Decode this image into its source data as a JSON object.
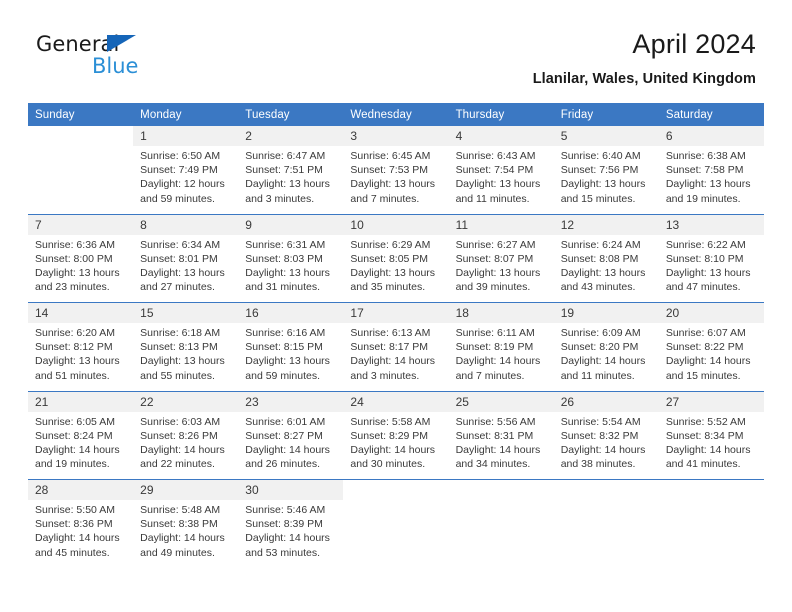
{
  "brand": {
    "line1": "General",
    "line2": "Blue",
    "triangle_color": "#1565b8",
    "line2_color": "#2b8fd6"
  },
  "header": {
    "title": "April 2024",
    "subtitle": "Llanilar, Wales, United Kingdom"
  },
  "theme": {
    "header_bg": "#3b78c3",
    "header_text": "#ffffff",
    "daynum_bg": "#f1f1f1",
    "rule_color": "#3b78c3",
    "body_text": "#3a3a3a"
  },
  "weekday_headers": [
    "Sunday",
    "Monday",
    "Tuesday",
    "Wednesday",
    "Thursday",
    "Friday",
    "Saturday"
  ],
  "weeks": [
    [
      {
        "day": "",
        "lines": []
      },
      {
        "day": "1",
        "lines": [
          "Sunrise: 6:50 AM",
          "Sunset: 7:49 PM",
          "Daylight: 12 hours",
          "and 59 minutes."
        ]
      },
      {
        "day": "2",
        "lines": [
          "Sunrise: 6:47 AM",
          "Sunset: 7:51 PM",
          "Daylight: 13 hours",
          "and 3 minutes."
        ]
      },
      {
        "day": "3",
        "lines": [
          "Sunrise: 6:45 AM",
          "Sunset: 7:53 PM",
          "Daylight: 13 hours",
          "and 7 minutes."
        ]
      },
      {
        "day": "4",
        "lines": [
          "Sunrise: 6:43 AM",
          "Sunset: 7:54 PM",
          "Daylight: 13 hours",
          "and 11 minutes."
        ]
      },
      {
        "day": "5",
        "lines": [
          "Sunrise: 6:40 AM",
          "Sunset: 7:56 PM",
          "Daylight: 13 hours",
          "and 15 minutes."
        ]
      },
      {
        "day": "6",
        "lines": [
          "Sunrise: 6:38 AM",
          "Sunset: 7:58 PM",
          "Daylight: 13 hours",
          "and 19 minutes."
        ]
      }
    ],
    [
      {
        "day": "7",
        "lines": [
          "Sunrise: 6:36 AM",
          "Sunset: 8:00 PM",
          "Daylight: 13 hours",
          "and 23 minutes."
        ]
      },
      {
        "day": "8",
        "lines": [
          "Sunrise: 6:34 AM",
          "Sunset: 8:01 PM",
          "Daylight: 13 hours",
          "and 27 minutes."
        ]
      },
      {
        "day": "9",
        "lines": [
          "Sunrise: 6:31 AM",
          "Sunset: 8:03 PM",
          "Daylight: 13 hours",
          "and 31 minutes."
        ]
      },
      {
        "day": "10",
        "lines": [
          "Sunrise: 6:29 AM",
          "Sunset: 8:05 PM",
          "Daylight: 13 hours",
          "and 35 minutes."
        ]
      },
      {
        "day": "11",
        "lines": [
          "Sunrise: 6:27 AM",
          "Sunset: 8:07 PM",
          "Daylight: 13 hours",
          "and 39 minutes."
        ]
      },
      {
        "day": "12",
        "lines": [
          "Sunrise: 6:24 AM",
          "Sunset: 8:08 PM",
          "Daylight: 13 hours",
          "and 43 minutes."
        ]
      },
      {
        "day": "13",
        "lines": [
          "Sunrise: 6:22 AM",
          "Sunset: 8:10 PM",
          "Daylight: 13 hours",
          "and 47 minutes."
        ]
      }
    ],
    [
      {
        "day": "14",
        "lines": [
          "Sunrise: 6:20 AM",
          "Sunset: 8:12 PM",
          "Daylight: 13 hours",
          "and 51 minutes."
        ]
      },
      {
        "day": "15",
        "lines": [
          "Sunrise: 6:18 AM",
          "Sunset: 8:13 PM",
          "Daylight: 13 hours",
          "and 55 minutes."
        ]
      },
      {
        "day": "16",
        "lines": [
          "Sunrise: 6:16 AM",
          "Sunset: 8:15 PM",
          "Daylight: 13 hours",
          "and 59 minutes."
        ]
      },
      {
        "day": "17",
        "lines": [
          "Sunrise: 6:13 AM",
          "Sunset: 8:17 PM",
          "Daylight: 14 hours",
          "and 3 minutes."
        ]
      },
      {
        "day": "18",
        "lines": [
          "Sunrise: 6:11 AM",
          "Sunset: 8:19 PM",
          "Daylight: 14 hours",
          "and 7 minutes."
        ]
      },
      {
        "day": "19",
        "lines": [
          "Sunrise: 6:09 AM",
          "Sunset: 8:20 PM",
          "Daylight: 14 hours",
          "and 11 minutes."
        ]
      },
      {
        "day": "20",
        "lines": [
          "Sunrise: 6:07 AM",
          "Sunset: 8:22 PM",
          "Daylight: 14 hours",
          "and 15 minutes."
        ]
      }
    ],
    [
      {
        "day": "21",
        "lines": [
          "Sunrise: 6:05 AM",
          "Sunset: 8:24 PM",
          "Daylight: 14 hours",
          "and 19 minutes."
        ]
      },
      {
        "day": "22",
        "lines": [
          "Sunrise: 6:03 AM",
          "Sunset: 8:26 PM",
          "Daylight: 14 hours",
          "and 22 minutes."
        ]
      },
      {
        "day": "23",
        "lines": [
          "Sunrise: 6:01 AM",
          "Sunset: 8:27 PM",
          "Daylight: 14 hours",
          "and 26 minutes."
        ]
      },
      {
        "day": "24",
        "lines": [
          "Sunrise: 5:58 AM",
          "Sunset: 8:29 PM",
          "Daylight: 14 hours",
          "and 30 minutes."
        ]
      },
      {
        "day": "25",
        "lines": [
          "Sunrise: 5:56 AM",
          "Sunset: 8:31 PM",
          "Daylight: 14 hours",
          "and 34 minutes."
        ]
      },
      {
        "day": "26",
        "lines": [
          "Sunrise: 5:54 AM",
          "Sunset: 8:32 PM",
          "Daylight: 14 hours",
          "and 38 minutes."
        ]
      },
      {
        "day": "27",
        "lines": [
          "Sunrise: 5:52 AM",
          "Sunset: 8:34 PM",
          "Daylight: 14 hours",
          "and 41 minutes."
        ]
      }
    ],
    [
      {
        "day": "28",
        "lines": [
          "Sunrise: 5:50 AM",
          "Sunset: 8:36 PM",
          "Daylight: 14 hours",
          "and 45 minutes."
        ]
      },
      {
        "day": "29",
        "lines": [
          "Sunrise: 5:48 AM",
          "Sunset: 8:38 PM",
          "Daylight: 14 hours",
          "and 49 minutes."
        ]
      },
      {
        "day": "30",
        "lines": [
          "Sunrise: 5:46 AM",
          "Sunset: 8:39 PM",
          "Daylight: 14 hours",
          "and 53 minutes."
        ]
      },
      {
        "day": "",
        "lines": []
      },
      {
        "day": "",
        "lines": []
      },
      {
        "day": "",
        "lines": []
      },
      {
        "day": "",
        "lines": []
      }
    ]
  ]
}
